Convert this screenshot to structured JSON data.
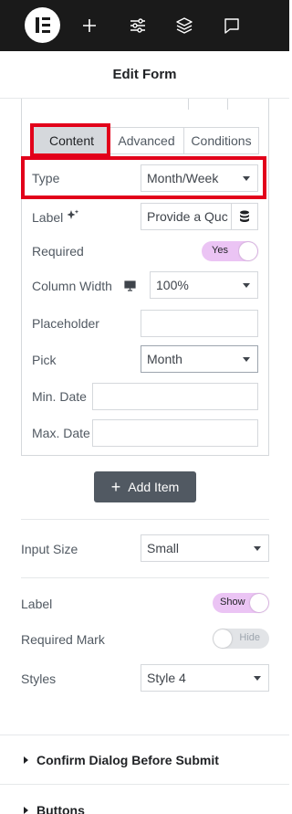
{
  "header": {
    "title": "Edit Form"
  },
  "tabs": {
    "content": "Content",
    "advanced": "Advanced",
    "conditions": "Conditions"
  },
  "item": {
    "type": {
      "label": "Type",
      "value": "Month/Week"
    },
    "label": {
      "label": "Label",
      "value": "Provide a Quc"
    },
    "required": {
      "label": "Required",
      "toggle": "Yes"
    },
    "column_width": {
      "label": "Column Width",
      "value": "100%"
    },
    "placeholder": {
      "label": "Placeholder",
      "value": ""
    },
    "pick": {
      "label": "Pick",
      "value": "Month"
    },
    "min_date": {
      "label": "Min. Date",
      "value": ""
    },
    "max_date": {
      "label": "Max. Date",
      "value": ""
    }
  },
  "add_item": "Add Item",
  "input_size": {
    "label": "Input Size",
    "value": "Small"
  },
  "label_toggle": {
    "label": "Label",
    "toggle": "Show"
  },
  "required_mark": {
    "label": "Required Mark",
    "toggle": "Hide"
  },
  "styles": {
    "label": "Styles",
    "value": "Style 4"
  },
  "sections": {
    "confirm_dialog": "Confirm Dialog Before Submit",
    "buttons": "Buttons"
  },
  "colors": {
    "toolbar": "#1a1a1a",
    "toggle_on": "#ebc4f4",
    "highlight": "#e2001a",
    "add_button": "#515962"
  }
}
